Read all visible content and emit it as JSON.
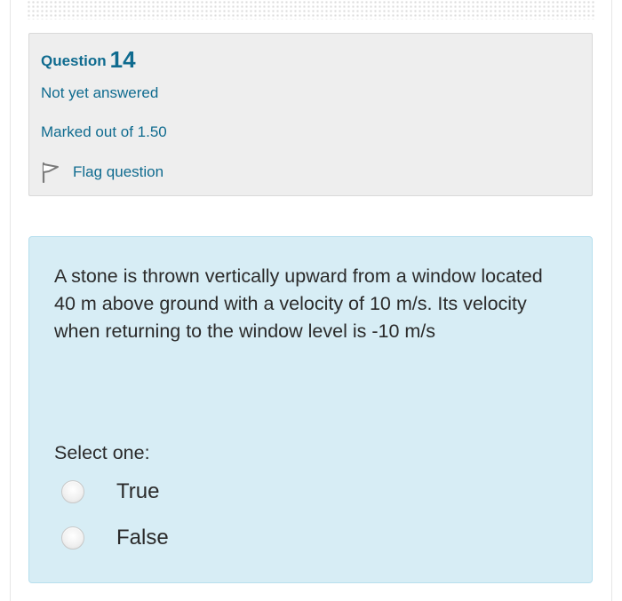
{
  "question_info": {
    "label": "Question",
    "number": "14",
    "state": "Not yet answered",
    "grade": "Marked out of 1.50",
    "flag_label": "Flag question"
  },
  "question": {
    "text": "A stone is thrown vertically upward from a window located 40 m above ground with a velocity of 10 m/s. Its velocity when returning to the window level is -10 m/s",
    "prompt": "Select one:",
    "options": [
      {
        "label": "True",
        "selected": false
      },
      {
        "label": "False",
        "selected": false
      }
    ]
  },
  "colors": {
    "accent": "#0f6b8f",
    "info_background": "#eeeeee",
    "question_background": "#d7edf5",
    "question_border": "#b7dfee",
    "text": "#2b2b2b"
  }
}
